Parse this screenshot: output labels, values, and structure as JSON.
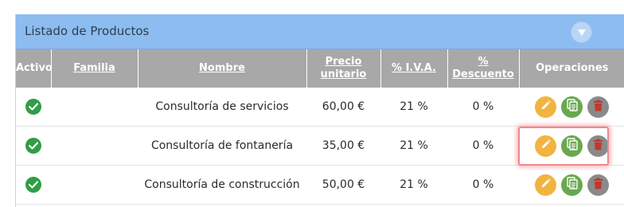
{
  "panel": {
    "title": "Listado de Productos",
    "collapse_icon": "chevron-down-icon"
  },
  "table": {
    "columns": [
      {
        "label_line1": "Activo",
        "label_line2": "",
        "sortable": false
      },
      {
        "label_line1": "Familia",
        "label_line2": "",
        "sortable": true
      },
      {
        "label_line1": "Nombre",
        "label_line2": "",
        "sortable": true
      },
      {
        "label_line1": "Precio",
        "label_line2": "unitario",
        "sortable": true
      },
      {
        "label_line1": "% I.V.A.",
        "label_line2": "",
        "sortable": true
      },
      {
        "label_line1": "% Descuento",
        "label_line2": "",
        "sortable": true
      },
      {
        "label_line1": "Operaciones",
        "label_line2": "",
        "sortable": false
      }
    ],
    "rows": [
      {
        "active": true,
        "familia": "",
        "nombre": "Consultoría de servicios",
        "precio": "60,00 €",
        "iva": "21 %",
        "descuento": "0 %"
      },
      {
        "active": true,
        "familia": "",
        "nombre": "Consultoría de fontanería",
        "precio": "35,00 €",
        "iva": "21 %",
        "descuento": "0 %"
      },
      {
        "active": true,
        "familia": "",
        "nombre": "Consultoría de construcción",
        "precio": "50,00 €",
        "iva": "21 %",
        "descuento": "0 %"
      }
    ],
    "operations": [
      "pencil-icon",
      "copy-icon",
      "trash-icon"
    ]
  },
  "colors": {
    "header_bg": "#8cbcf0",
    "table_header_bg": "#a8a8a8",
    "active_green": "#2f9e44",
    "edit_orange": "#f2b440",
    "copy_green": "#6aa84f",
    "delete_gray": "#8a8a8a",
    "delete_red": "#c0392b",
    "highlight_red": "#f1888e"
  }
}
